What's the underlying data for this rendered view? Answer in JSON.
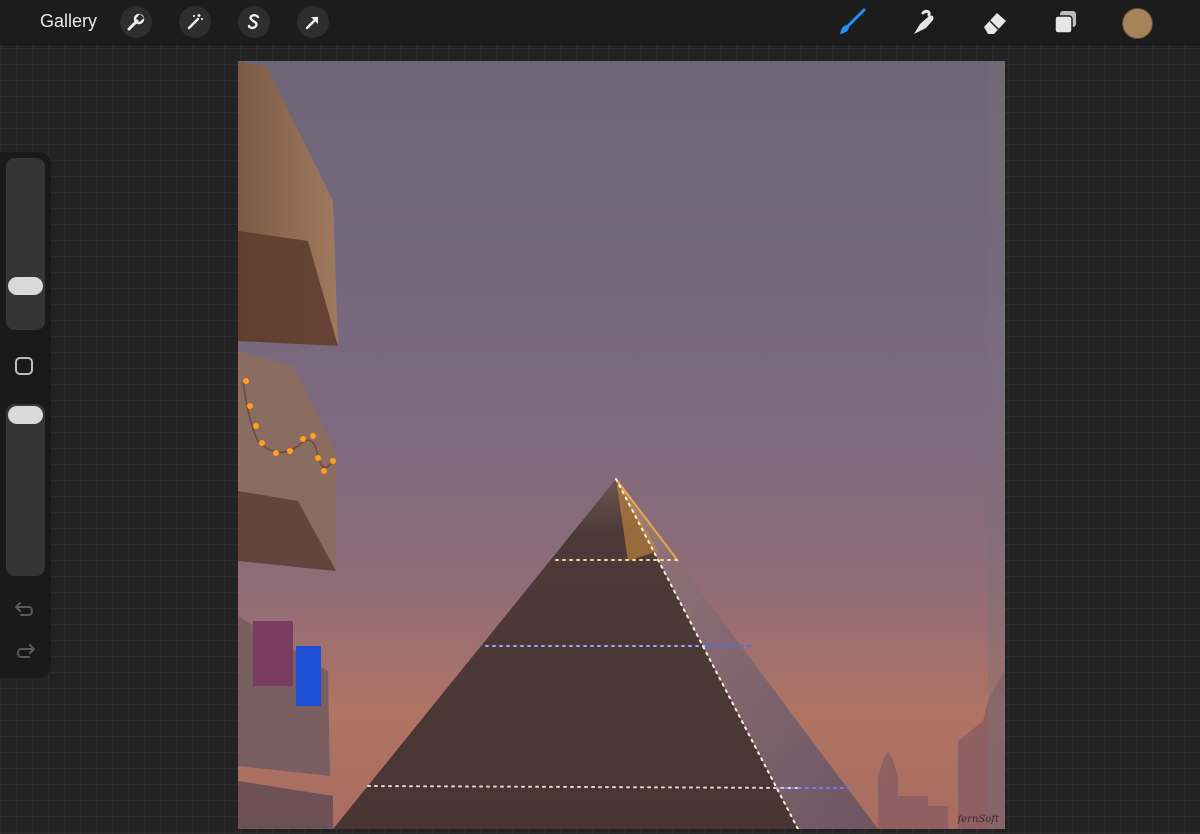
{
  "topbar": {
    "gallery_label": "Gallery",
    "left_tools": [
      "wrench-icon",
      "magic-wand-icon",
      "selection-s-icon",
      "transform-arrow-icon"
    ],
    "right_tools": [
      "brush-icon",
      "smudge-icon",
      "eraser-icon",
      "layers-icon"
    ],
    "active_tool": "brush-icon",
    "accent_color": "#1e90ff",
    "current_color": "#a6845a"
  },
  "sidebar": {
    "brush_size": 0.22,
    "brush_opacity": 1.0,
    "icons": [
      "modify-square-icon",
      "undo-icon",
      "redo-icon"
    ]
  },
  "artwork": {
    "signature": "fernSoft",
    "palette": {
      "sky_top": "#6f6577",
      "sky_mid": "#7e6a80",
      "sky_low": "#b37560",
      "pyramid_dark": "#4e3b39",
      "pyramid_light": "#8a7077",
      "lights_warm": "#ffcf6b",
      "lights_blue": "#5a7bff",
      "lantern_orange": "#ff9a1f",
      "cloth_blue": "#1f4fd6",
      "cloth_purple": "#7a3d62"
    }
  }
}
